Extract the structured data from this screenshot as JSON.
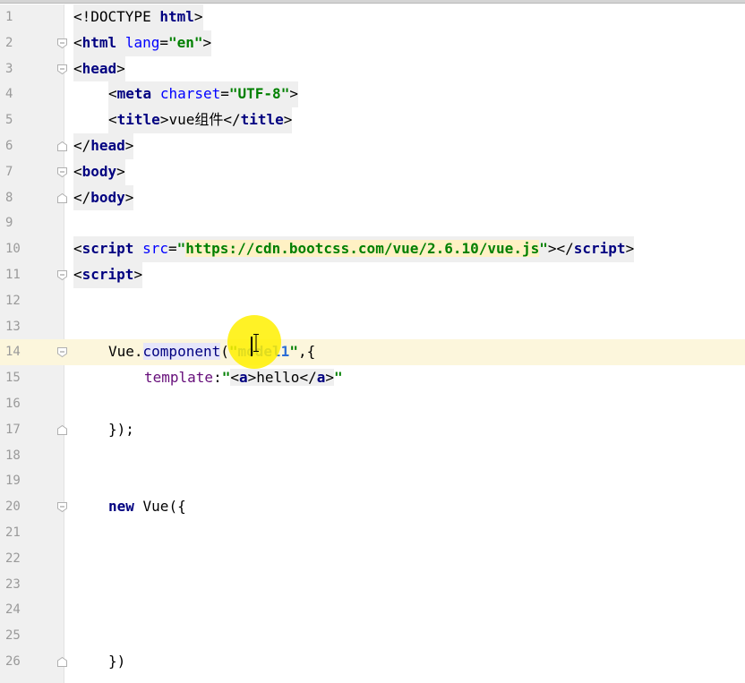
{
  "editor": {
    "lines": [
      {
        "number": "1",
        "tokens": [
          "<!DOCTYPE ",
          "html",
          ">"
        ]
      },
      {
        "number": "2",
        "tokens": [
          "<",
          "html",
          " ",
          "lang",
          "=",
          "\"en\"",
          ">"
        ]
      },
      {
        "number": "3",
        "tokens": [
          "<",
          "head",
          ">"
        ]
      },
      {
        "number": "4",
        "tokens": [
          "<",
          "meta",
          " ",
          "charset",
          "=",
          "\"UTF-8\"",
          ">"
        ]
      },
      {
        "number": "5",
        "tokens": [
          "<",
          "title",
          ">",
          "vue组件",
          "</",
          "title",
          ">"
        ]
      },
      {
        "number": "6",
        "tokens": [
          "</",
          "head",
          ">"
        ]
      },
      {
        "number": "7",
        "tokens": [
          "<",
          "body",
          ">"
        ]
      },
      {
        "number": "8",
        "tokens": [
          "</",
          "body",
          ">"
        ]
      },
      {
        "number": "9",
        "tokens": []
      },
      {
        "number": "10",
        "tokens": [
          "<",
          "script",
          " ",
          "src",
          "=",
          "\"",
          "https://cdn.bootcss.com/vue/2.6.10/vue.js",
          "\"",
          ">",
          "</",
          "script",
          ">"
        ]
      },
      {
        "number": "11",
        "tokens": [
          "<",
          "script",
          ">"
        ]
      },
      {
        "number": "12",
        "tokens": []
      },
      {
        "number": "13",
        "tokens": []
      },
      {
        "number": "14",
        "tokens": [
          "Vue.",
          "component",
          "(",
          "\"",
          "model1",
          "\"",
          ",{"
        ]
      },
      {
        "number": "15",
        "tokens": [
          "template",
          ":",
          "\"",
          "<",
          "a",
          ">",
          "hello",
          "</",
          "a",
          ">",
          "\""
        ]
      },
      {
        "number": "16",
        "tokens": []
      },
      {
        "number": "17",
        "tokens": [
          "});"
        ]
      },
      {
        "number": "18",
        "tokens": []
      },
      {
        "number": "19",
        "tokens": []
      },
      {
        "number": "20",
        "tokens": [
          "new",
          " Vue({"
        ]
      },
      {
        "number": "21",
        "tokens": []
      },
      {
        "number": "22",
        "tokens": []
      },
      {
        "number": "23",
        "tokens": []
      },
      {
        "number": "24",
        "tokens": []
      },
      {
        "number": "25",
        "tokens": []
      },
      {
        "number": "26",
        "tokens": [
          "})"
        ]
      }
    ]
  },
  "colors": {
    "tag": "#000080",
    "attribute": "#0000ff",
    "string": "#008000",
    "keyword": "#000080",
    "current_line": "#fcf6dc",
    "gutter": "#f0f0f0",
    "cursor_halo": "#fff000"
  },
  "icons": {
    "fold": "fold-marker-icon",
    "cursor": "mouse-cursor-halo"
  }
}
